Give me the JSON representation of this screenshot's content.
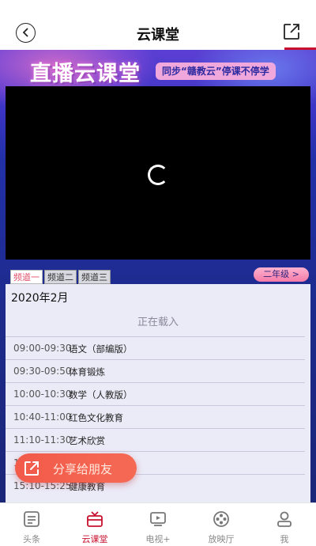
{
  "header": {
    "title": "云课堂"
  },
  "banner": {
    "title": "直播云课堂",
    "tag": "同步“赣教云”停课不停学"
  },
  "tabs": [
    {
      "label": "频道一",
      "active": true
    },
    {
      "label": "频道二",
      "active": false
    },
    {
      "label": "频道三",
      "active": false
    }
  ],
  "grade_button": "二年级 >",
  "schedule": {
    "month": "2020年2月",
    "loading_text": "正在载入",
    "rows": [
      {
        "time": "09:00-09:30",
        "subject": "语文（部编版）"
      },
      {
        "time": "09:30-09:50",
        "subject": "体育锻炼"
      },
      {
        "time": "10:00-10:30",
        "subject": "数学（人教版）"
      },
      {
        "time": "10:40-11:00",
        "subject": "红色文化教育"
      },
      {
        "time": "11:10-11:30",
        "subject": "艺术欣赏"
      },
      {
        "time": "1",
        "subject": ""
      },
      {
        "time": "15:10-15:25",
        "subject": "健康教育"
      }
    ]
  },
  "share_button": "分享给朋友",
  "bottom_nav": [
    {
      "label": "头条",
      "icon": "news-icon",
      "active": false
    },
    {
      "label": "云课堂",
      "icon": "classroom-icon",
      "active": true
    },
    {
      "label": "电视+",
      "icon": "tv-icon",
      "active": false
    },
    {
      "label": "放映厅",
      "icon": "film-reel-icon",
      "active": false
    },
    {
      "label": "我",
      "icon": "user-icon",
      "active": false
    }
  ],
  "colors": {
    "accent": "#c8102e",
    "banner_bg": "#1d2a8a",
    "share_bg": "#f25a4a"
  }
}
